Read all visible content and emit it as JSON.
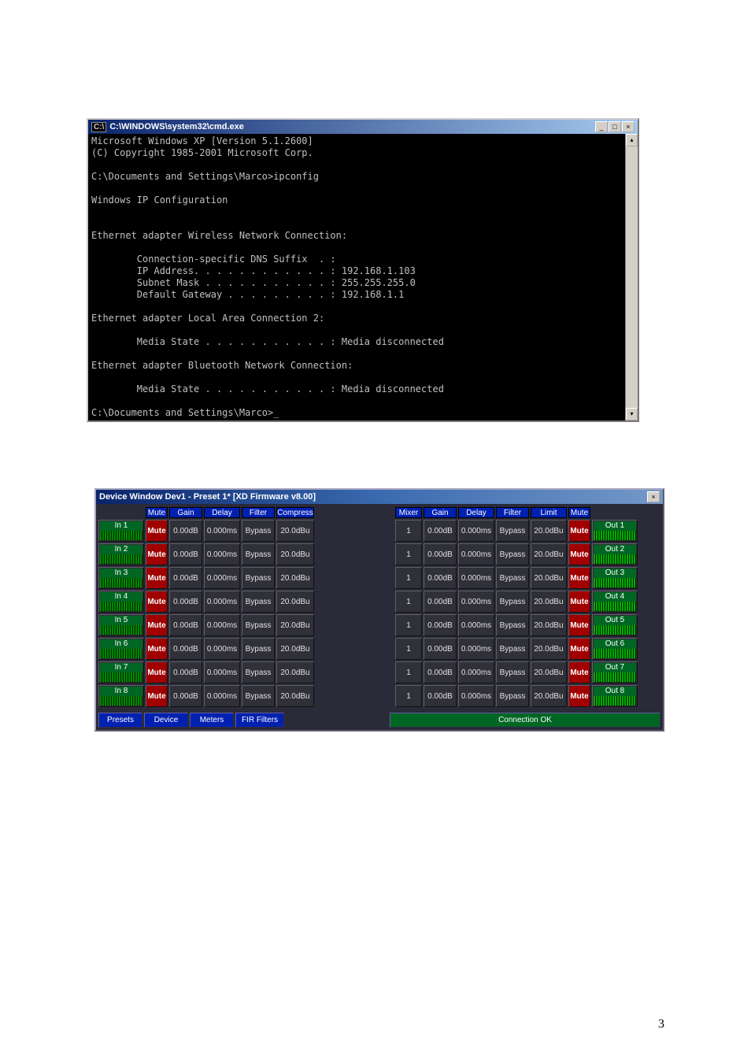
{
  "page_number": "3",
  "cmd": {
    "title": "C:\\WINDOWS\\system32\\cmd.exe",
    "icon": "cmd-icon",
    "body": "Microsoft Windows XP [Version 5.1.2600]\n(C) Copyright 1985-2001 Microsoft Corp.\n\nC:\\Documents and Settings\\Marco>ipconfig\n\nWindows IP Configuration\n\n\nEthernet adapter Wireless Network Connection:\n\n        Connection-specific DNS Suffix  . :\n        IP Address. . . . . . . . . . . . : 192.168.1.103\n        Subnet Mask . . . . . . . . . . . : 255.255.255.0\n        Default Gateway . . . . . . . . . : 192.168.1.1\n\nEthernet adapter Local Area Connection 2:\n\n        Media State . . . . . . . . . . . : Media disconnected\n\nEthernet adapter Bluetooth Network Connection:\n\n        Media State . . . . . . . . . . . : Media disconnected\n\nC:\\Documents and Settings\\Marco>_"
  },
  "dev": {
    "title": "Device Window Dev1 -  Preset 1*  [XD Firmware v8.00]",
    "headers_in": [
      "",
      "Mute",
      "Gain",
      "Delay",
      "Filter",
      "Compress"
    ],
    "headers_out": [
      "Mixer",
      "Gain",
      "Delay",
      "Filter",
      "Limit",
      "Mute",
      ""
    ],
    "mute_label": "Mute",
    "inputs": [
      {
        "label": "In 1",
        "gain": "0.00dB",
        "delay": "0.000ms",
        "filter": "Bypass",
        "compress": "20.0dBu"
      },
      {
        "label": "In 2",
        "gain": "0.00dB",
        "delay": "0.000ms",
        "filter": "Bypass",
        "compress": "20.0dBu"
      },
      {
        "label": "In 3",
        "gain": "0.00dB",
        "delay": "0.000ms",
        "filter": "Bypass",
        "compress": "20.0dBu"
      },
      {
        "label": "In 4",
        "gain": "0.00dB",
        "delay": "0.000ms",
        "filter": "Bypass",
        "compress": "20.0dBu"
      },
      {
        "label": "In 5",
        "gain": "0.00dB",
        "delay": "0.000ms",
        "filter": "Bypass",
        "compress": "20.0dBu"
      },
      {
        "label": "In 6",
        "gain": "0.00dB",
        "delay": "0.000ms",
        "filter": "Bypass",
        "compress": "20.0dBu"
      },
      {
        "label": "In 7",
        "gain": "0.00dB",
        "delay": "0.000ms",
        "filter": "Bypass",
        "compress": "20.0dBu"
      },
      {
        "label": "In 8",
        "gain": "0.00dB",
        "delay": "0.000ms",
        "filter": "Bypass",
        "compress": "20.0dBu"
      }
    ],
    "outputs": [
      {
        "mixer": "1",
        "gain": "0.00dB",
        "delay": "0.000ms",
        "filter": "Bypass",
        "limit": "20.0dBu",
        "label": "Out 1"
      },
      {
        "mixer": "1",
        "gain": "0.00dB",
        "delay": "0.000ms",
        "filter": "Bypass",
        "limit": "20.0dBu",
        "label": "Out 2"
      },
      {
        "mixer": "1",
        "gain": "0.00dB",
        "delay": "0.000ms",
        "filter": "Bypass",
        "limit": "20.0dBu",
        "label": "Out 3"
      },
      {
        "mixer": "1",
        "gain": "0.00dB",
        "delay": "0.000ms",
        "filter": "Bypass",
        "limit": "20.0dBu",
        "label": "Out 4"
      },
      {
        "mixer": "1",
        "gain": "0.00dB",
        "delay": "0.000ms",
        "filter": "Bypass",
        "limit": "20.0dBu",
        "label": "Out 5"
      },
      {
        "mixer": "1",
        "gain": "0.00dB",
        "delay": "0.000ms",
        "filter": "Bypass",
        "limit": "20.0dBu",
        "label": "Out 6"
      },
      {
        "mixer": "1",
        "gain": "0.00dB",
        "delay": "0.000ms",
        "filter": "Bypass",
        "limit": "20.0dBu",
        "label": "Out 7"
      },
      {
        "mixer": "1",
        "gain": "0.00dB",
        "delay": "0.000ms",
        "filter": "Bypass",
        "limit": "20.0dBu",
        "label": "Out 8"
      }
    ],
    "footer": {
      "presets": "Presets",
      "device": "Device",
      "meters": "Meters",
      "fir": "FIR Filters",
      "status": "Connection OK"
    }
  }
}
